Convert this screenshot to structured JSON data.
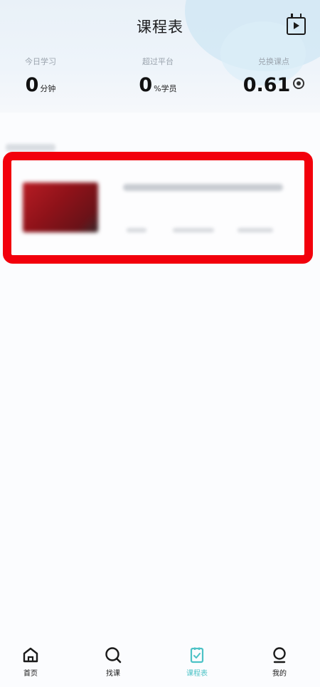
{
  "header": {
    "title": "课程表",
    "play_icon": "calendar-play-icon"
  },
  "stats": [
    {
      "label": "今日学习",
      "value": "0",
      "unit": "分钟"
    },
    {
      "label": "超过平台",
      "value": "0",
      "unit": "%学员"
    },
    {
      "label": "兑换课点",
      "value": "0.61",
      "unit": "",
      "icon": "coin-icon"
    }
  ],
  "tabs": [
    {
      "label": "首页",
      "icon": "home-icon",
      "active": false
    },
    {
      "label": "找课",
      "icon": "search-icon",
      "active": false
    },
    {
      "label": "课程表",
      "icon": "schedule-icon",
      "active": true
    },
    {
      "label": "我的",
      "icon": "profile-icon",
      "active": false
    }
  ],
  "colors": {
    "accent": "#4cc2c6",
    "highlight_border": "#f2000c",
    "thumbnail": "#a0161e"
  }
}
